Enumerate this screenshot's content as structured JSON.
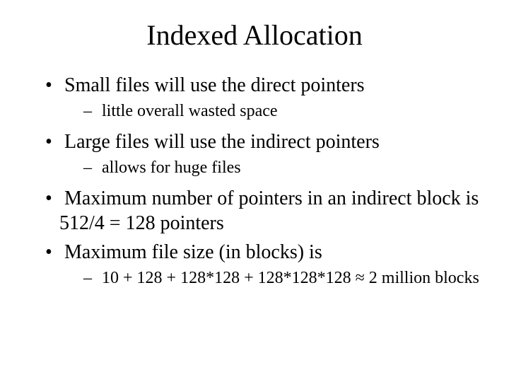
{
  "title": "Indexed Allocation",
  "bullet1": "Small files will use the direct pointers",
  "sub1": "little overall wasted space",
  "bullet2": "Large files will use the indirect pointers",
  "sub2": "allows for huge files",
  "bullet3": "Maximum number of pointers in an indirect block is 512/4 = 128 pointers",
  "bullet4": "Maximum file size (in blocks) is",
  "sub4": "10 + 128 + 128*128 + 128*128*128 ≈ 2 million blocks"
}
